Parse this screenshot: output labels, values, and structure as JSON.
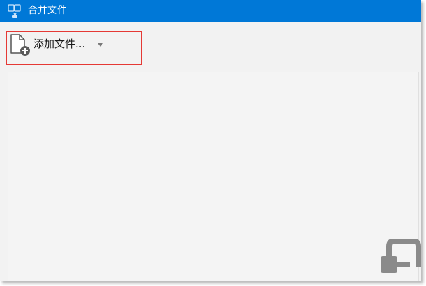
{
  "window": {
    "title": "合并文件",
    "title_icon": "merge-files-icon"
  },
  "toolbar": {
    "add_files_label": "添加文件...",
    "add_files_icon": "file-add-icon",
    "has_dropdown": true
  },
  "file_list": {
    "items": []
  },
  "colors": {
    "titlebar": "#0078d7",
    "background": "#f2f2f2",
    "highlight": "#e53935"
  }
}
